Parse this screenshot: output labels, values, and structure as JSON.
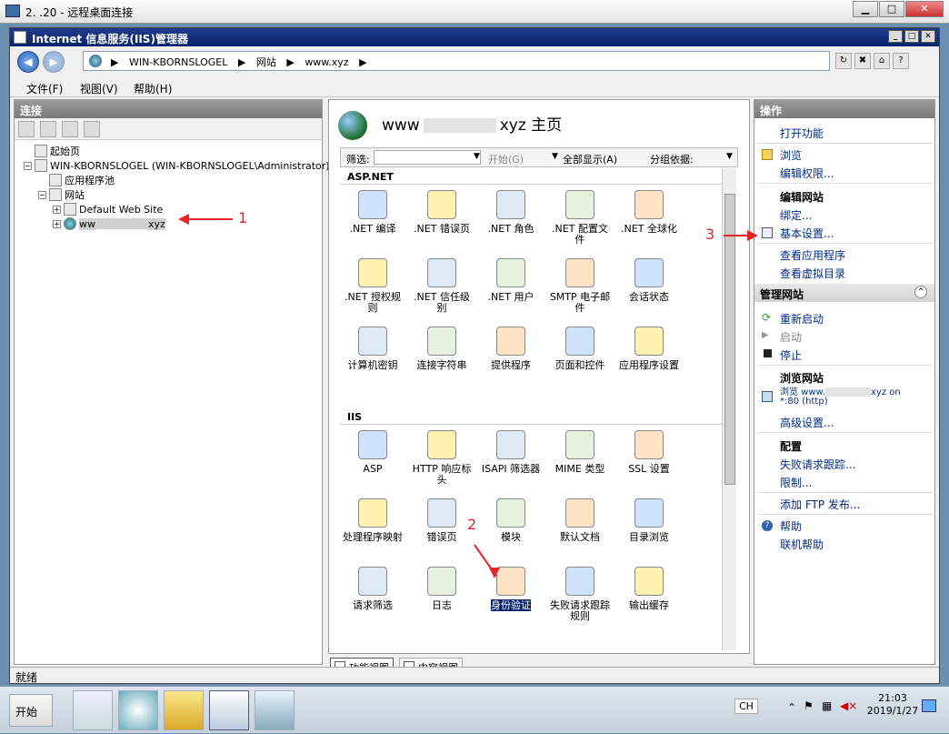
{
  "rdp": {
    "title": "2.             .20 - 远程桌面连接"
  },
  "iis": {
    "title": "Internet 信息服务(IIS)管理器"
  },
  "address": {
    "parts": [
      "WIN-KBORNSLOGEL",
      "网站",
      "www.xyz"
    ],
    "sep": "▶"
  },
  "menu": {
    "file": "文件(F)",
    "view": "视图(V)",
    "help": "帮助(H)"
  },
  "connections": {
    "header": "连接",
    "tree": {
      "start_page": "起始页",
      "server": "WIN-KBORNSLOGEL (WIN-KBORNSLOGEL\\Administrator)",
      "app_pools": "应用程序池",
      "sites": "网站",
      "default_site": "Default Web Site",
      "site_prefix": "ww",
      "site_suffix": "xyz"
    }
  },
  "center": {
    "title_prefix": "www",
    "title_suffix": "xyz  主页",
    "filter_label": "筛选:",
    "start_label": "开始(G)",
    "show_all": "全部显示(A)",
    "group_by": "分组依据:",
    "sections": [
      "ASP.NET",
      "IIS"
    ],
    "aspnet": [
      ".NET 编译",
      ".NET 错误页",
      ".NET 角色",
      ".NET 配置文件",
      ".NET 全球化",
      ".NET 授权规则",
      ".NET 信任级别",
      ".NET 用户",
      "SMTP 电子邮件",
      "会话状态",
      "计算机密钥",
      "连接字符串",
      "提供程序",
      "页面和控件",
      "应用程序设置"
    ],
    "iis_feats": [
      "ASP",
      "HTTP 响应标头",
      "ISAPI 筛选器",
      "MIME 类型",
      "SSL 设置",
      "处理程序映射",
      "错误页",
      "模块",
      "默认文档",
      "目录浏览",
      "请求筛选",
      "日志",
      "身份验证",
      "失败请求跟踪规则",
      "输出缓存"
    ],
    "tab_features": "功能视图",
    "tab_content": "内容视图"
  },
  "actions": {
    "header": "操作",
    "open_feature": "打开功能",
    "browse": "浏览",
    "edit_perms": "编辑权限...",
    "edit_site": "编辑网站",
    "bindings": "绑定...",
    "basic_settings": "基本设置...",
    "view_apps": "查看应用程序",
    "view_vdirs": "查看虚拟目录",
    "manage_site": "管理网站",
    "restart": "重新启动",
    "start": "启动",
    "stop": "停止",
    "browse_site": "浏览网站",
    "browse_link_1": "浏览 www.",
    "browse_link_1b": "xyz on",
    "browse_link_2": "*:80 (http)",
    "advanced": "高级设置...",
    "config": "配置",
    "failed_req": "失败请求跟踪...",
    "limits": "限制...",
    "add_ftp": "添加 FTP 发布...",
    "help": "帮助",
    "online_help": "联机帮助"
  },
  "status": {
    "text": "就绪"
  },
  "taskbar": {
    "start": "开始",
    "lang": "CH",
    "time": "21:03",
    "date": "2019/1/27"
  },
  "annotations": {
    "n1": "1",
    "n2": "2",
    "n3": "3"
  }
}
